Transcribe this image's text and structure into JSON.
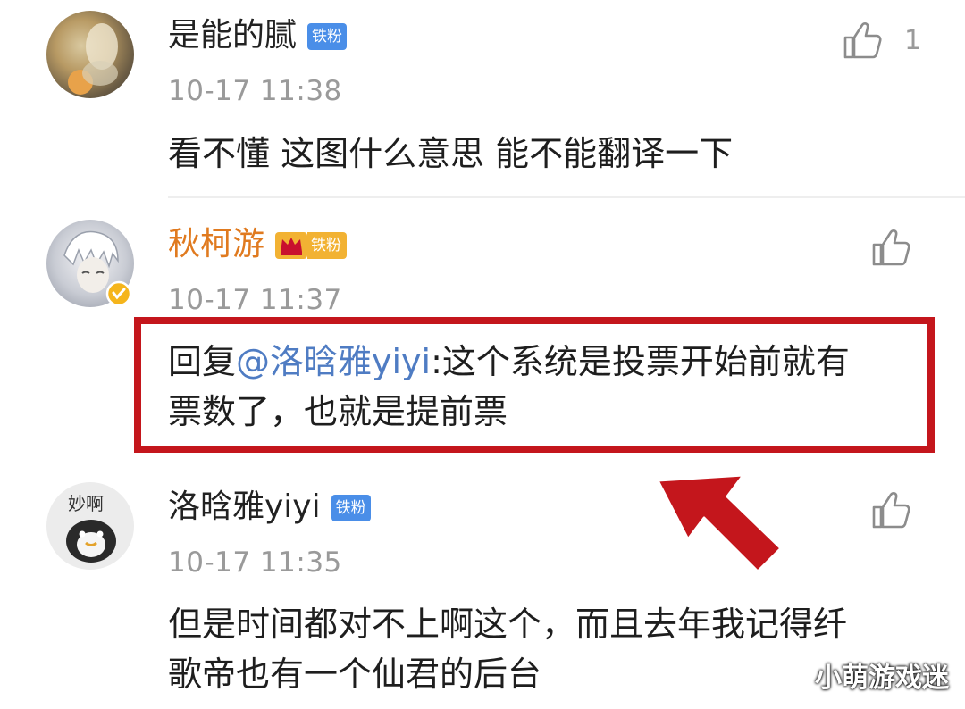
{
  "comments": [
    {
      "username": "是能的腻",
      "badge": "铁粉",
      "time": "10-17 11:38",
      "text": "看不懂 这图什么意思 能不能翻译一下",
      "like_count": "1"
    },
    {
      "username": "秋柯游",
      "badge": "铁粉",
      "time": "10-17 11:37",
      "reply_prefix": "回复",
      "mention": "@洛晗雅yiyi",
      "text_line1": ":这个系统是投票开始前就有",
      "text_line2": "票数了，也就是提前票"
    },
    {
      "username": "洛晗雅yiyi",
      "badge": "铁粉",
      "time": "10-17 11:35",
      "text_line1": "但是时间都对不上啊这个，而且去年我记得纤",
      "text_line2": "歌帝也有一个仙君的后台"
    }
  ],
  "avatar3_text": "妙啊",
  "watermark": "小萌游戏迷",
  "colors": {
    "badge_blue": "#4a8ee8",
    "vip_gold": "#f2b233",
    "vip_name_orange": "#e07a1f",
    "mention_blue": "#4f7cc3",
    "highlight_red": "#c4161c",
    "time_gray": "#9a9a9a"
  },
  "icons": [
    "thumbs-up-icon",
    "crown-icon",
    "verified-icon",
    "arrow-icon"
  ]
}
